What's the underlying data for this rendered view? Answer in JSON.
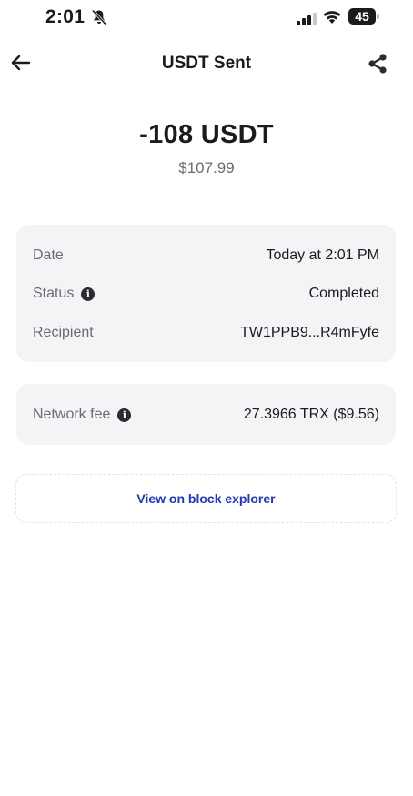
{
  "status_bar": {
    "time": "2:01",
    "battery": "45",
    "icons": [
      "bell-slash-icon",
      "signal-icon",
      "wifi-icon",
      "battery-icon"
    ]
  },
  "header": {
    "title": "USDT Sent",
    "back_icon": "arrow-left-icon",
    "share_icon": "share-icon"
  },
  "transaction": {
    "amount": "-108 USDT",
    "fiat_value": "$107.99"
  },
  "details": {
    "date_label": "Date",
    "date_value": "Today at 2:01 PM",
    "status_label": "Status",
    "status_value": "Completed",
    "recipient_label": "Recipient",
    "recipient_value": "TW1PPB9...R4mFyfe"
  },
  "fee": {
    "label": "Network fee",
    "value": "27.3966 TRX ($9.56)"
  },
  "explorer": {
    "link_text": "View on block explorer"
  },
  "colors": {
    "link": "#1f37c4",
    "card_background": "#f4f4f7",
    "secondary_text": "#6b6b72"
  }
}
